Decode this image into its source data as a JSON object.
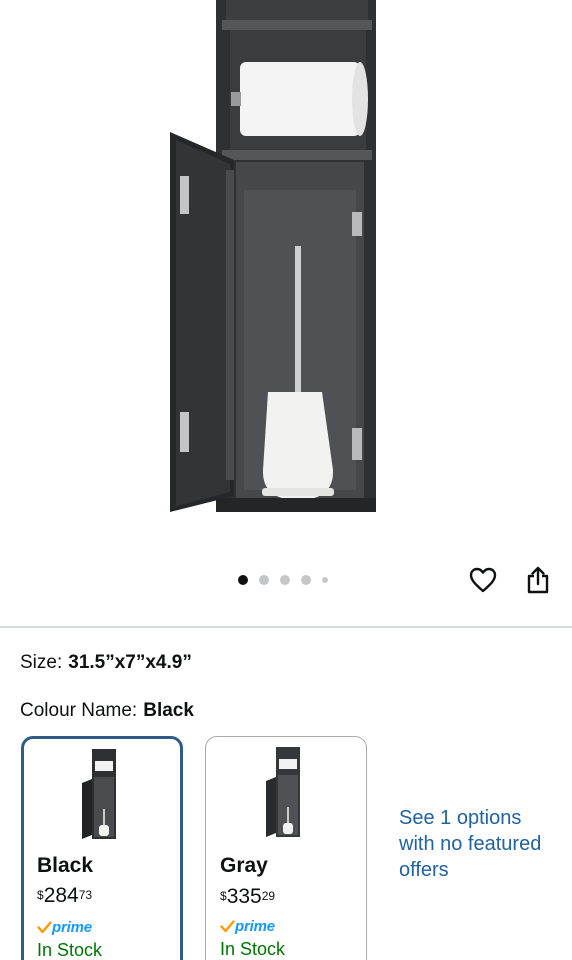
{
  "carousel": {
    "count": 5,
    "active_index": 0
  },
  "size": {
    "label": "Size:",
    "value": "31.5”x7”x4.9”"
  },
  "colour": {
    "label": "Colour Name:",
    "value": "Black"
  },
  "swatches": [
    {
      "name": "Black",
      "price_symbol": "$",
      "price_whole": "284",
      "price_fraction": "73",
      "prime_label": "prime",
      "stock": "In Stock",
      "selected": true
    },
    {
      "name": "Gray",
      "price_symbol": "$",
      "price_whole": "335",
      "price_fraction": "29",
      "prime_label": "prime",
      "stock": "In Stock",
      "selected": false
    }
  ],
  "other_offers_link": "See 1 options with no featured offers",
  "icons": {
    "favorite": "heart-icon",
    "share": "share-icon",
    "prime_check": "prime-check-icon"
  },
  "colors": {
    "selected_border": "#2f5c86",
    "prime_blue": "#1399ff",
    "stock_green": "#007600",
    "link_blue": "#2162a1",
    "cabinet": "#3a3b3d"
  }
}
